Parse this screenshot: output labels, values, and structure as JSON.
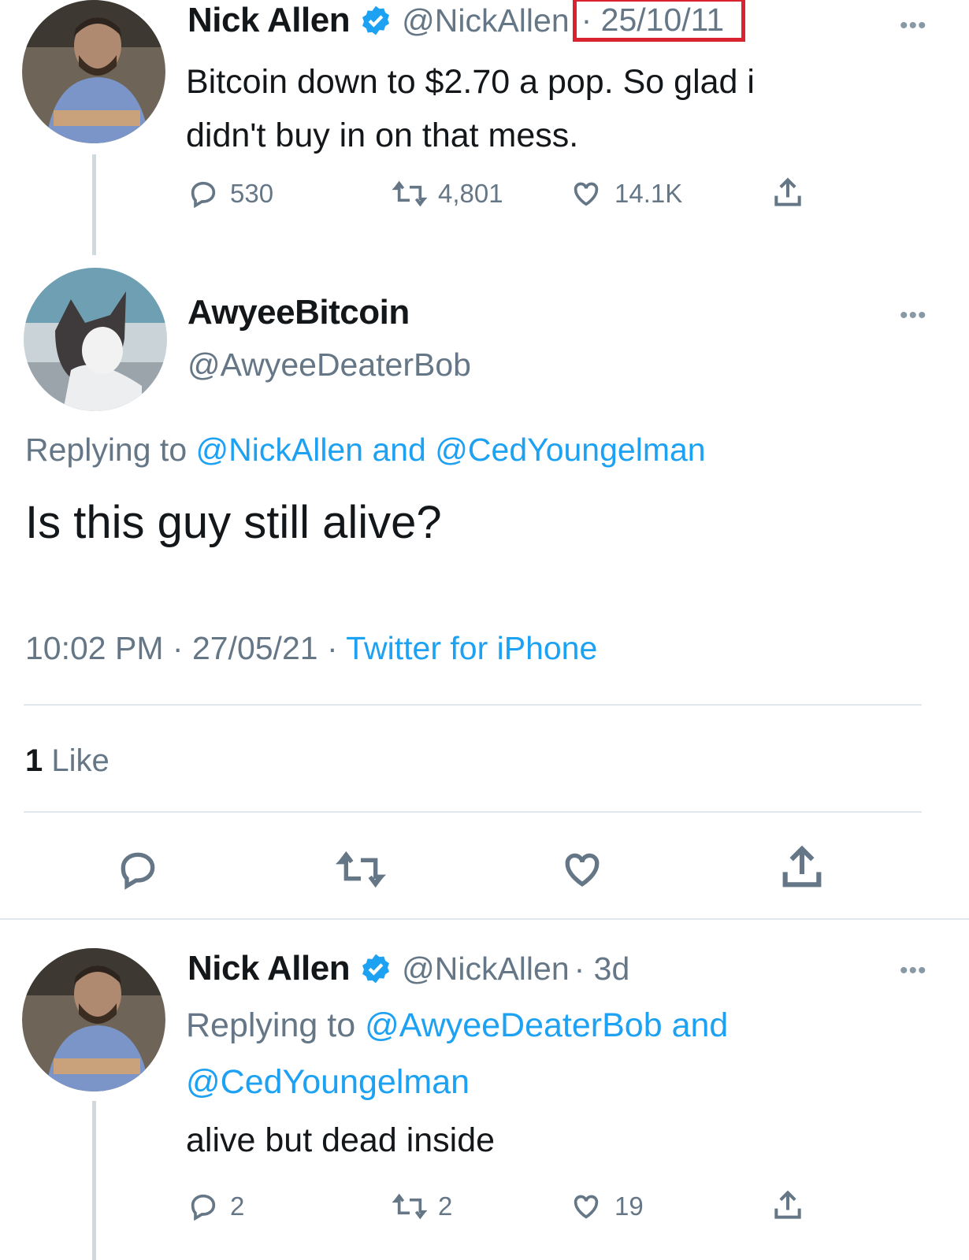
{
  "tweet1": {
    "name": "Nick Allen",
    "handle": "@NickAllen",
    "date": "· 25/10/11",
    "text_line1": "Bitcoin down to $2.70 a pop. So glad i",
    "text_line2": "didn't buy in on that mess.",
    "replies": "530",
    "retweets": "4,801",
    "likes": "14.1K"
  },
  "main_tweet": {
    "name": "AwyeeBitcoin",
    "handle": "@AwyeeDeaterBob",
    "replying_prefix": "Replying to",
    "replying_to_1": "@NickAllen",
    "replying_and": "and",
    "replying_to_2": "@CedYoungelman",
    "text": "Is this guy still alive?",
    "time": "10:02 PM",
    "date": "· 27/05/21 ·",
    "source": "Twitter for iPhone",
    "like_count": "1",
    "like_label": "Like"
  },
  "tweet3": {
    "name": "Nick Allen",
    "handle": "@NickAllen",
    "time": "· 3d",
    "replying_prefix": "Replying to",
    "replying_to_1": "@AwyeeDeaterBob",
    "replying_and": "and",
    "replying_to_2": "@CedYoungelman",
    "text": "alive but dead inside",
    "replies": "2",
    "retweets": "2",
    "likes": "19"
  },
  "colors": {
    "accent": "#1da1f2",
    "muted": "#657786",
    "highlight_box": "#d9232f"
  },
  "icons": [
    "verified-badge-icon",
    "more-icon",
    "reply-icon",
    "retweet-icon",
    "like-icon",
    "share-icon"
  ]
}
